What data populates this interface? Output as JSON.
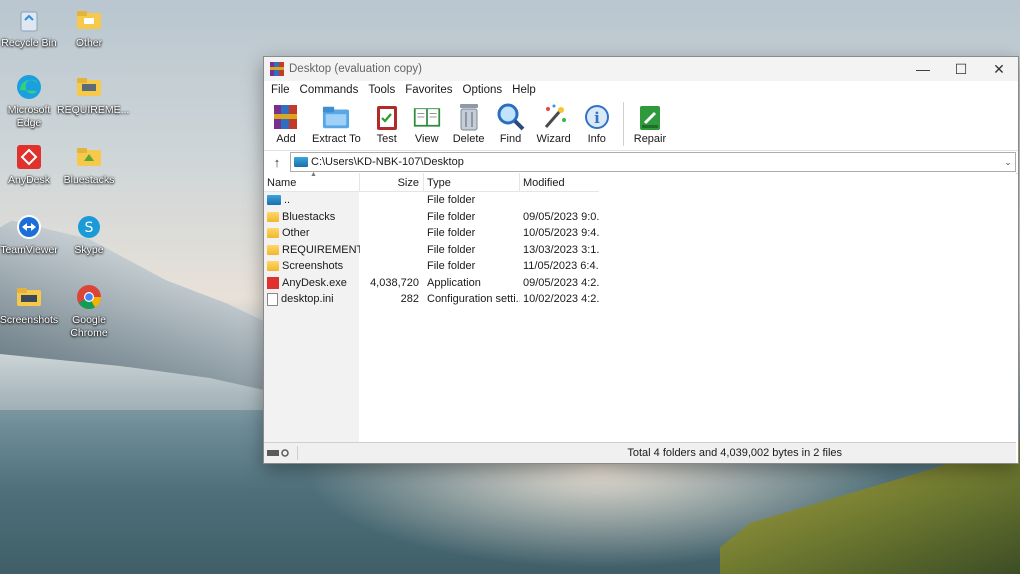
{
  "desktop": {
    "icons": [
      {
        "label": "Recycle Bin"
      },
      {
        "label": "Other"
      },
      {
        "label": "Microsoft Edge"
      },
      {
        "label": "REQUIREME..."
      },
      {
        "label": "AnyDesk"
      },
      {
        "label": "Bluestacks"
      },
      {
        "label": "TeamViewer"
      },
      {
        "label": "Skype"
      },
      {
        "label": "Screenshots"
      },
      {
        "label": "Google Chrome"
      }
    ]
  },
  "window": {
    "title": "Desktop (evaluation copy)",
    "controls": {
      "minimize": "—",
      "maximize": "☐",
      "close": "✕"
    },
    "menu": [
      "File",
      "Commands",
      "Tools",
      "Favorites",
      "Options",
      "Help"
    ],
    "toolbar": [
      "Add",
      "Extract To",
      "Test",
      "View",
      "Delete",
      "Find",
      "Wizard",
      "Info",
      "Repair"
    ],
    "address": "C:\\Users\\KD-NBK-107\\Desktop",
    "columns": {
      "name": "Name",
      "size": "Size",
      "type": "Type",
      "modified": "Modified"
    },
    "files": [
      {
        "name": "..",
        "size": "",
        "type": "File folder",
        "modified": ""
      },
      {
        "name": "Bluestacks",
        "size": "",
        "type": "File folder",
        "modified": "09/05/2023 9:0..."
      },
      {
        "name": "Other",
        "size": "",
        "type": "File folder",
        "modified": "10/05/2023 9:4..."
      },
      {
        "name": "REQUIREMENTS",
        "size": "",
        "type": "File folder",
        "modified": "13/03/2023 3:1..."
      },
      {
        "name": "Screenshots",
        "size": "",
        "type": "File folder",
        "modified": "11/05/2023 6:4..."
      },
      {
        "name": "AnyDesk.exe",
        "size": "4,038,720",
        "type": "Application",
        "modified": "09/05/2023 4:2..."
      },
      {
        "name": "desktop.ini",
        "size": "282",
        "type": "Configuration setti...",
        "modified": "10/02/2023 4:2..."
      }
    ],
    "status": "Total 4 folders and 4,039,002 bytes in 2 files"
  },
  "colors": {
    "accent": "#0078d4",
    "folder": "#f2b630",
    "anydesk": "#e0322c"
  }
}
